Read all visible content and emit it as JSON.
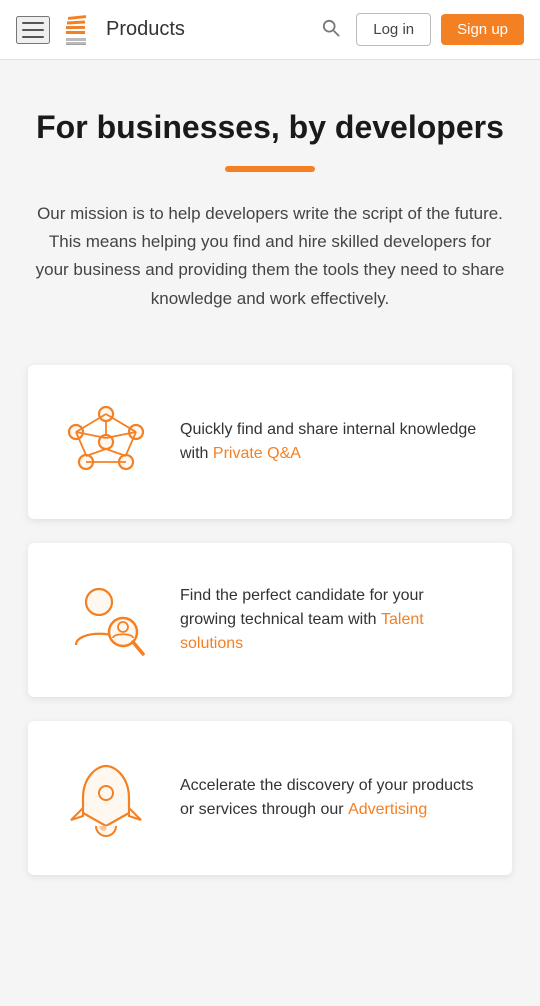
{
  "header": {
    "nav_title": "Products",
    "login_label": "Log in",
    "signup_label": "Sign up"
  },
  "hero": {
    "title": "For businesses, by developers",
    "description": "Our mission is to help developers write the script of the future. This means helping you find and hire skilled developers for your business and providing them the tools they need to share knowledge and work effectively."
  },
  "cards": [
    {
      "id": "private-qa",
      "description_before": "Quickly find and share internal knowledge with ",
      "link_text": "Private Q&A",
      "description_after": ""
    },
    {
      "id": "talent",
      "description_before": "Find the perfect candidate for your growing technical team with ",
      "link_text": "Talent solutions",
      "description_after": ""
    },
    {
      "id": "advertising",
      "description_before": "Accelerate the discovery of your products or services through our ",
      "link_text": "Advertising",
      "description_after": ""
    }
  ]
}
